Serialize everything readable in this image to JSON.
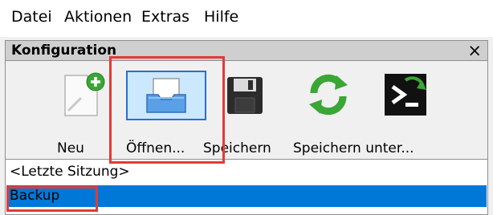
{
  "menubar": {
    "items": [
      {
        "label": "Datei"
      },
      {
        "label": "Aktionen"
      },
      {
        "label": "Extras"
      },
      {
        "label": "Hilfe"
      }
    ]
  },
  "panel": {
    "title": "Konfiguration",
    "close_label": "×"
  },
  "toolbar": {
    "buttons": [
      {
        "label": "Neu",
        "icon": "new-document-icon"
      },
      {
        "label": "Öffnen...",
        "icon": "open-tray-icon"
      },
      {
        "label": "Speichern",
        "icon": "floppy-disk-icon"
      },
      {
        "label": "Speichern unter...",
        "icon": "refresh-save-as-icon"
      },
      {
        "label": "",
        "icon": "console-terminal-icon"
      }
    ]
  },
  "session_list": {
    "items": [
      {
        "label": "<Letzte Sitzung>",
        "selected": false
      },
      {
        "label": "Backup",
        "selected": true
      }
    ]
  },
  "colors": {
    "selection": "#0078d7",
    "highlight_box": "#e53935",
    "open_button_hover": "#cce8ff"
  }
}
